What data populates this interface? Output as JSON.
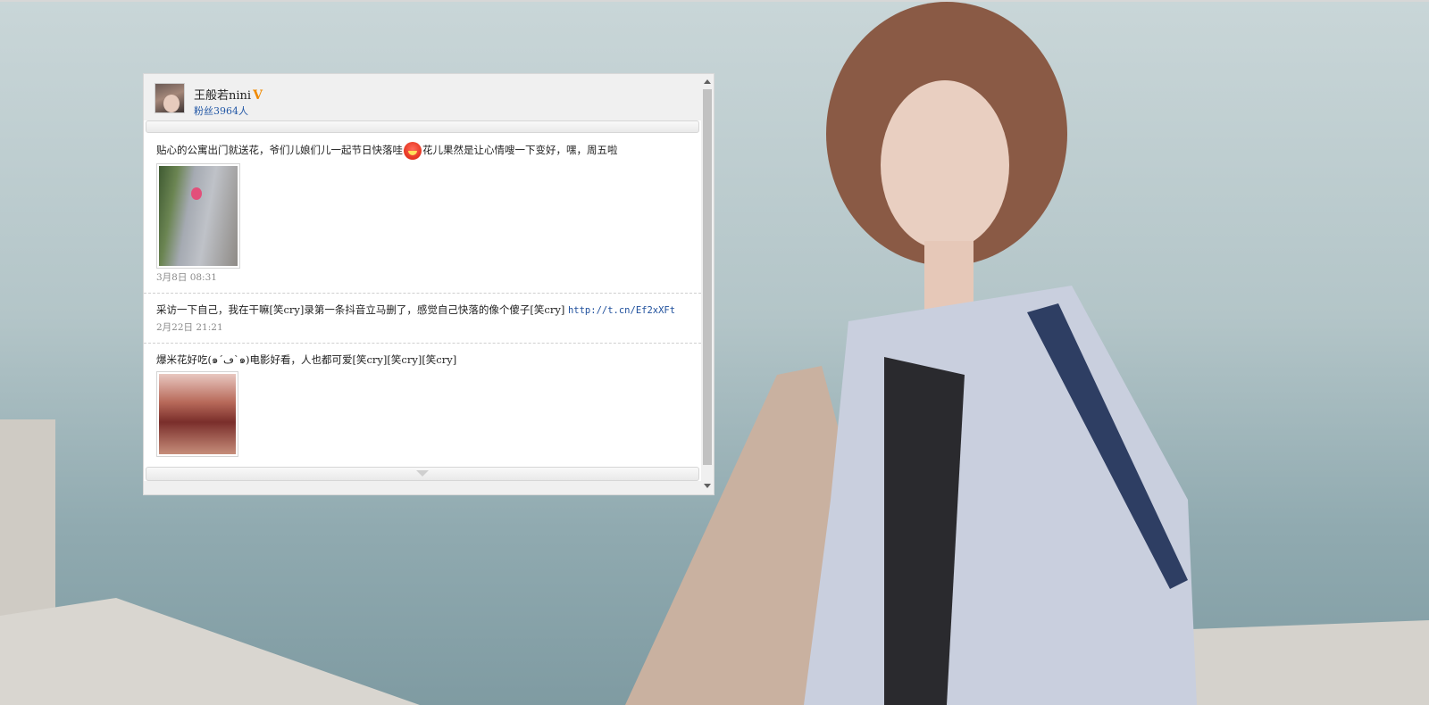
{
  "profile": {
    "name": "王般若nini",
    "verified_badge": "V",
    "fans": "粉丝3964人"
  },
  "posts": [
    {
      "text_before": "贴心的公寓出门就送花，爷们儿娘们儿一起节日快落哇",
      "emoji": "laughing-face",
      "text_after": "花儿果然是让心情嗖一下变好，嘿，周五啦",
      "time": "3月8日 08:31"
    },
    {
      "text": "采访一下自己，我在干嘛[笑cry]录第一条抖音立马删了，感觉自己快落的像个傻子[笑cry] ",
      "link": "http://t.cn/Ef2xXFt",
      "time": "2月22日 21:21"
    },
    {
      "text": "爆米花好吃(๑´ڡ`๑)电影好看，人也都可爱[笑cry][笑cry][笑cry]"
    }
  ],
  "colors": {
    "link": "#1e4f9c",
    "verified": "#f08a00",
    "fans": "#2358a6"
  }
}
